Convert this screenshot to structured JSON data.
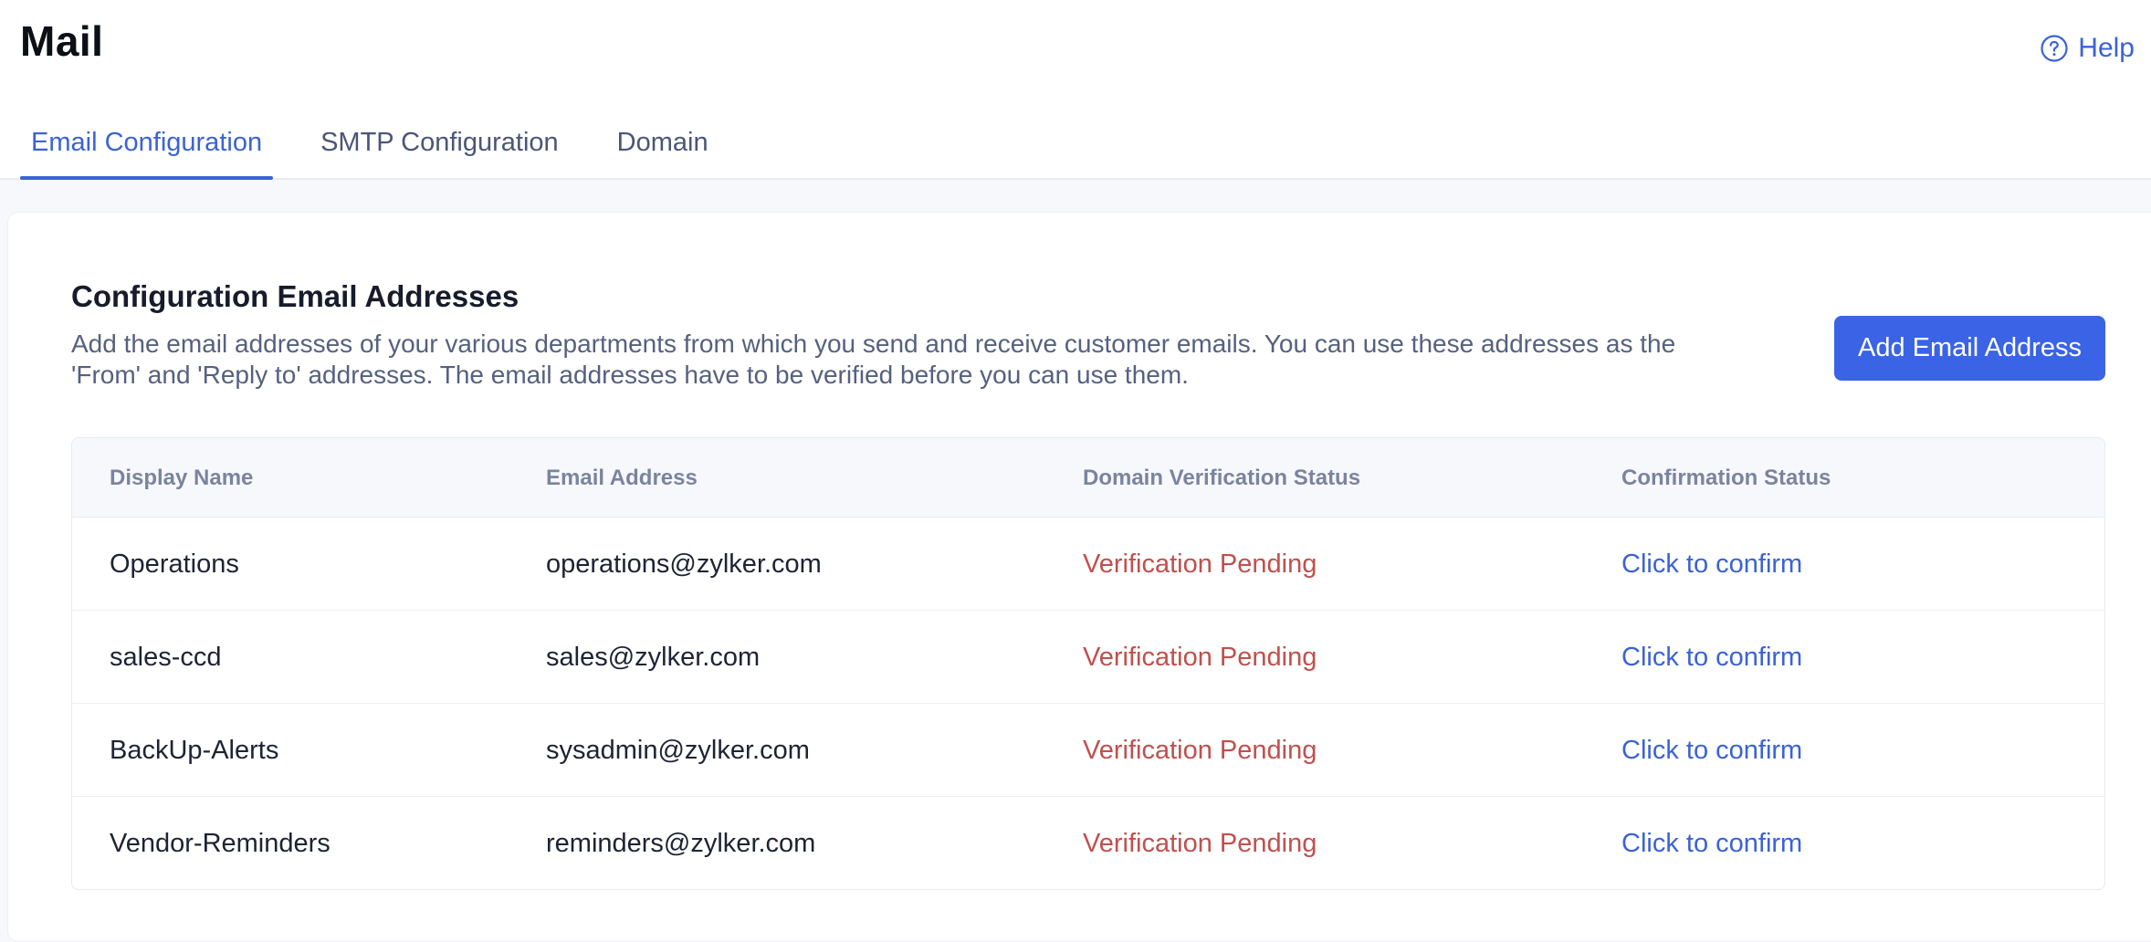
{
  "page": {
    "title": "Mail",
    "help_label": "Help"
  },
  "tabs": [
    {
      "label": "Email Configuration",
      "active": true
    },
    {
      "label": "SMTP Configuration",
      "active": false
    },
    {
      "label": "Domain",
      "active": false
    }
  ],
  "section": {
    "title": "Configuration Email Addresses",
    "description": "Add the email addresses of your various departments from which you send and receive customer emails. You can use these addresses as the 'From' and 'Reply to' addresses. The email addresses have to be verified before you can use them.",
    "add_button_label": "Add Email Address"
  },
  "table": {
    "columns": [
      "Display Name",
      "Email Address",
      "Domain Verification Status",
      "Confirmation Status"
    ],
    "rows": [
      {
        "display_name": "Operations",
        "email": "operations@zylker.com",
        "domain_status": "Verification Pending",
        "confirmation": "Click to confirm"
      },
      {
        "display_name": "sales-ccd",
        "email": "sales@zylker.com",
        "domain_status": "Verification Pending",
        "confirmation": "Click to confirm"
      },
      {
        "display_name": "BackUp-Alerts",
        "email": "sysadmin@zylker.com",
        "domain_status": "Verification Pending",
        "confirmation": "Click to confirm"
      },
      {
        "display_name": "Vendor-Reminders",
        "email": "reminders@zylker.com",
        "domain_status": "Verification Pending",
        "confirmation": "Click to confirm"
      }
    ]
  },
  "colors": {
    "accent": "#3b62d6",
    "button": "#3a63e6",
    "pending": "#c0504d"
  },
  "icons": {
    "help": "question-circle-icon"
  }
}
